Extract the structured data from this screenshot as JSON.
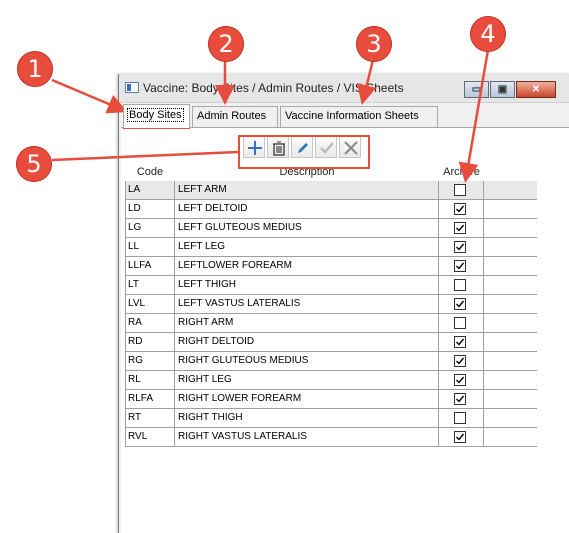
{
  "window": {
    "title": "Vaccine: Body Sites / Admin Routes / VIS Sheets",
    "min_glyph": "▭",
    "max_glyph": "▣",
    "close_glyph": "✕"
  },
  "tabs": [
    {
      "label": "Body Sites"
    },
    {
      "label": "Admin Routes"
    },
    {
      "label": "Vaccine Information Sheets"
    }
  ],
  "grid": {
    "headers": {
      "code": "Code",
      "description": "Description",
      "archive": "Archive"
    },
    "rows": [
      {
        "code": "LA",
        "description": "LEFT ARM",
        "archive": false
      },
      {
        "code": "LD",
        "description": "LEFT DELTOID",
        "archive": true
      },
      {
        "code": "LG",
        "description": "LEFT GLUTEOUS MEDIUS",
        "archive": true
      },
      {
        "code": "LL",
        "description": "LEFT LEG",
        "archive": true
      },
      {
        "code": "LLFA",
        "description": "LEFTLOWER FOREARM",
        "archive": true
      },
      {
        "code": "LT",
        "description": "LEFT THIGH",
        "archive": false
      },
      {
        "code": "LVL",
        "description": "LEFT VASTUS LATERALIS",
        "archive": true
      },
      {
        "code": "RA",
        "description": "RIGHT ARM",
        "archive": false
      },
      {
        "code": "RD",
        "description": "RIGHT DELTOID",
        "archive": true
      },
      {
        "code": "RG",
        "description": "RIGHT GLUTEOUS MEDIUS",
        "archive": true
      },
      {
        "code": "RL",
        "description": "RIGHT LEG",
        "archive": true
      },
      {
        "code": "RLFA",
        "description": "RIGHT LOWER FOREARM",
        "archive": true
      },
      {
        "code": "RT",
        "description": "RIGHT THIGH",
        "archive": false
      },
      {
        "code": "RVL",
        "description": "RIGHT VASTUS LATERALIS",
        "archive": true
      }
    ]
  },
  "toolbar": {
    "icons": [
      "add-icon",
      "delete-icon",
      "edit-icon",
      "save-icon",
      "cancel-icon"
    ]
  },
  "callouts": [
    "1",
    "2",
    "3",
    "4",
    "5"
  ],
  "colors": {
    "callout": "#e84c3d",
    "toolbar_blue": "#2f74c0"
  }
}
